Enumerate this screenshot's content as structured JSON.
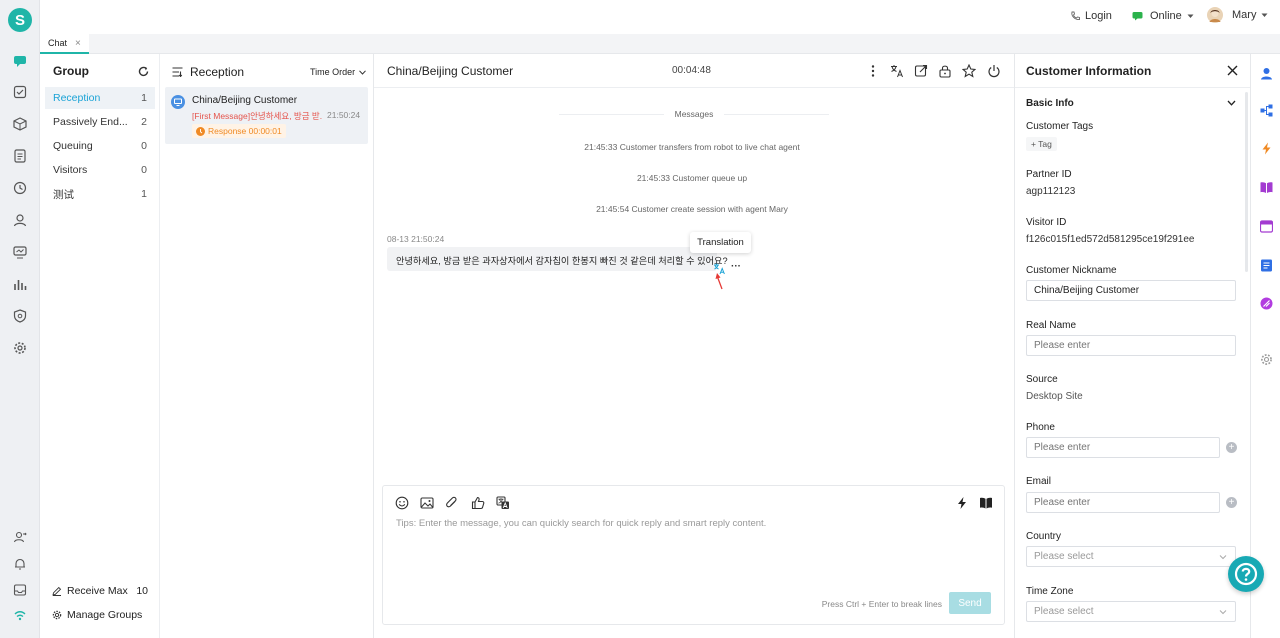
{
  "app": {
    "logo_letter": "S",
    "accent": "#1fb5a8"
  },
  "topbar": {
    "login_label": "Login",
    "status_label": "Online",
    "user_name": "Mary"
  },
  "tabs": [
    {
      "label": "Chat",
      "close": "×"
    }
  ],
  "group_panel": {
    "title": "Group",
    "items": [
      {
        "label": "Reception",
        "count": "1"
      },
      {
        "label": "Passively End...",
        "count": "2"
      },
      {
        "label": "Queuing",
        "count": "0"
      },
      {
        "label": "Visitors",
        "count": "0"
      },
      {
        "label": "测试",
        "count": "1"
      }
    ],
    "receive_max_label": "Receive Max",
    "receive_max_value": "10",
    "manage_groups_label": "Manage Groups"
  },
  "reception": {
    "title": "Reception",
    "sort_label": "Time Order",
    "card": {
      "name": "China/Beijing Customer",
      "preview": "[First Message]안녕하세요, 방금 받...",
      "time": "21:50:24",
      "response_label": "Response 00:00:01"
    }
  },
  "chat": {
    "title": "China/Beijing Customer",
    "timer": "00:04:48",
    "divider_label": "Messages",
    "system_messages": [
      "21:45:33 Customer transfers from robot to live chat agent",
      "21:45:33 Customer queue up",
      "21:45:54 Customer create session with agent Mary"
    ],
    "message": {
      "timestamp": "08-13 21:50:24",
      "text": "안녕하세요, 방금 받은 과자상자에서 감자칩이 한봉지 빠진 것 같은데 처리할 수 있어요?",
      "more": "···"
    },
    "tooltip": "Translation",
    "composer": {
      "placeholder": "Tips: Enter the message, you can quickly search for quick reply and smart reply content.",
      "hint": "Press Ctrl + Enter to break lines",
      "send_label": "Send"
    }
  },
  "customer_info": {
    "title": "Customer Information",
    "section": "Basic Info",
    "tags_label": "Customer Tags",
    "tag_button": "+ Tag",
    "partner_id_label": "Partner ID",
    "partner_id": "agp112123",
    "visitor_id_label": "Visitor ID",
    "visitor_id": "f126c015f1ed572d581295ce19f291ee",
    "nickname_label": "Customer Nickname",
    "nickname": "China/Beijing Customer",
    "real_name_label": "Real Name",
    "enter_placeholder": "Please enter",
    "select_placeholder": "Please select",
    "source_label": "Source",
    "source": "Desktop Site",
    "phone_label": "Phone",
    "email_label": "Email",
    "country_label": "Country",
    "timezone_label": "Time Zone"
  }
}
